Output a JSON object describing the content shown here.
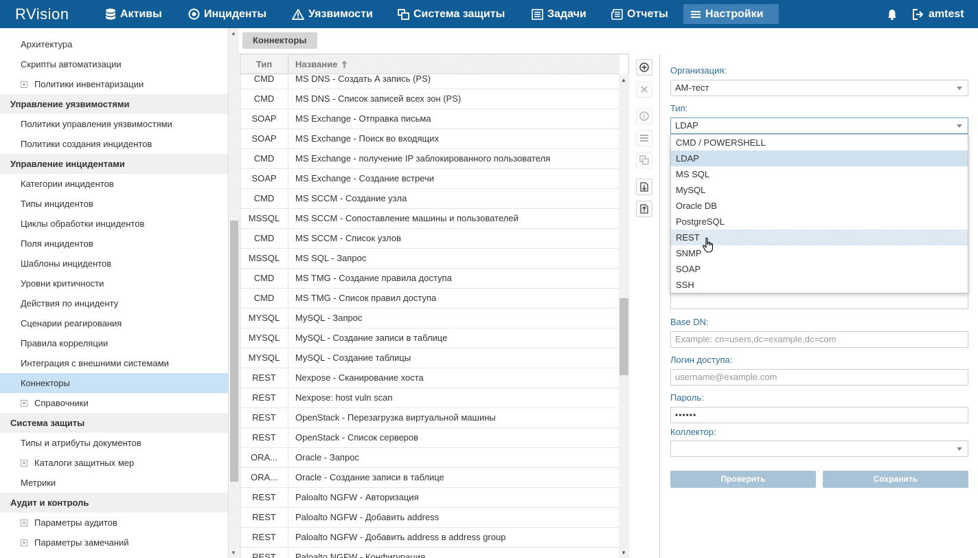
{
  "app": {
    "logo": "RVision",
    "user": "amtest"
  },
  "nav": [
    {
      "label": "Активы",
      "icon": "database-icon"
    },
    {
      "label": "Инциденты",
      "icon": "target-icon"
    },
    {
      "label": "Уязвимости",
      "icon": "warning-icon"
    },
    {
      "label": "Система защиты",
      "icon": "windows-icon"
    },
    {
      "label": "Задачи",
      "icon": "tasks-icon"
    },
    {
      "label": "Отчеты",
      "icon": "reports-icon"
    },
    {
      "label": "Настройки",
      "icon": "menu-icon",
      "active": true
    }
  ],
  "sidebar": [
    {
      "label": "Архитектура",
      "kind": "item"
    },
    {
      "label": "Скрипты автоматизации",
      "kind": "item"
    },
    {
      "label": "Политики инвентаризации",
      "kind": "expand"
    },
    {
      "label": "Управление уязвимостями",
      "kind": "group"
    },
    {
      "label": "Политики управления уязвимостями",
      "kind": "item"
    },
    {
      "label": "Политики создания инцидентов",
      "kind": "item"
    },
    {
      "label": "Управление инцидентами",
      "kind": "group"
    },
    {
      "label": "Категории инцидентов",
      "kind": "item"
    },
    {
      "label": "Типы инцидентов",
      "kind": "item"
    },
    {
      "label": "Циклы обработки инцидентов",
      "kind": "item"
    },
    {
      "label": "Поля инцидентов",
      "kind": "item"
    },
    {
      "label": "Шаблоны инцидентов",
      "kind": "item"
    },
    {
      "label": "Уровни критичности",
      "kind": "item"
    },
    {
      "label": "Действия по инциденту",
      "kind": "item"
    },
    {
      "label": "Сценарии реагирования",
      "kind": "item"
    },
    {
      "label": "Правила корреляции",
      "kind": "item"
    },
    {
      "label": "Интеграция с внешними системами",
      "kind": "item"
    },
    {
      "label": "Коннекторы",
      "kind": "item",
      "selected": true
    },
    {
      "label": "Справочники",
      "kind": "expand"
    },
    {
      "label": "Система защиты",
      "kind": "group"
    },
    {
      "label": "Типы и атрибуты документов",
      "kind": "item"
    },
    {
      "label": "Каталоги защитных мер",
      "kind": "expand"
    },
    {
      "label": "Метрики",
      "kind": "item"
    },
    {
      "label": "Аудит и контроль",
      "kind": "group"
    },
    {
      "label": "Параметры аудитов",
      "kind": "expand"
    },
    {
      "label": "Параметры замечаний",
      "kind": "expand"
    }
  ],
  "tab": {
    "label": "Коннекторы"
  },
  "table": {
    "headers": {
      "type": "Тип",
      "name": "Название"
    },
    "rows": [
      {
        "type": "CMD",
        "name": "MS DNS - Создать A запись (PS)"
      },
      {
        "type": "CMD",
        "name": "MS DNS - Список записей всех зон (PS)"
      },
      {
        "type": "SOAP",
        "name": "MS Exchange - Отправка письма"
      },
      {
        "type": "SOAP",
        "name": "MS Exchange - Поиск во входящих"
      },
      {
        "type": "CMD",
        "name": "MS Exchange - получение IP заблокированного пользователя"
      },
      {
        "type": "SOAP",
        "name": "MS Exchange - Создание встречи"
      },
      {
        "type": "CMD",
        "name": "MS SCCM - Создание узла"
      },
      {
        "type": "MSSQL",
        "name": "MS SCCM - Сопоставление машины и пользователей"
      },
      {
        "type": "CMD",
        "name": "MS SCCM - Список узлов"
      },
      {
        "type": "MSSQL",
        "name": "MS SQL - Запрос"
      },
      {
        "type": "CMD",
        "name": "MS TMG - Создание правила доступа"
      },
      {
        "type": "CMD",
        "name": "MS TMG - Список правил доступа"
      },
      {
        "type": "MYSQL",
        "name": "MySQL - Запрос"
      },
      {
        "type": "MYSQL",
        "name": "MySQL - Создание записи в таблице"
      },
      {
        "type": "MYSQL",
        "name": "MySQL - Создание таблицы"
      },
      {
        "type": "REST",
        "name": "Nexpose - Сканирование хоста"
      },
      {
        "type": "REST",
        "name": "Nexpose: host vuln scan"
      },
      {
        "type": "REST",
        "name": "OpenStack - Перезагрузка виртуальной машины"
      },
      {
        "type": "REST",
        "name": "OpenStack - Список серверов"
      },
      {
        "type": "ORA...",
        "name": "Oracle - Запрос"
      },
      {
        "type": "ORA...",
        "name": "Oracle - Создание записи в таблице"
      },
      {
        "type": "REST",
        "name": "Paloalto NGFW - Авторизация"
      },
      {
        "type": "REST",
        "name": "Paloalto NGFW - Добавить address"
      },
      {
        "type": "REST",
        "name": "Paloalto NGFW - Добавить address в address group"
      },
      {
        "type": "REST",
        "name": "Paloalto NGFW - Конфигурация"
      }
    ]
  },
  "form": {
    "org_label": "Организация:",
    "org_value": "АМ-тест",
    "type_label": "Тип:",
    "type_value": "LDAP",
    "type_options": [
      "CMD / POWERSHELL",
      "LDAP",
      "MS SQL",
      "MySQL",
      "Oracle DB",
      "PostgreSQL",
      "REST",
      "SNMP",
      "SOAP",
      "SSH"
    ],
    "type_selected": "LDAP",
    "type_hover": "REST",
    "basedn_label": "Base DN:",
    "basedn_placeholder": "Example: cn=users,dc=example,dc=com",
    "login_label": "Логин доступа:",
    "login_placeholder": "username@example.com",
    "password_label": "Пароль:",
    "password_value": "••••••",
    "collector_label": "Коллектор:",
    "collector_value": "",
    "check_button": "Проверить",
    "save_button": "Сохранить"
  },
  "colors": {
    "topbar": "#0f5c96",
    "nav_active": "#3e7fb5",
    "selected_row": "#c9e2f5",
    "label": "#2f6d9b",
    "button_disabled": "#a9c3d6"
  }
}
